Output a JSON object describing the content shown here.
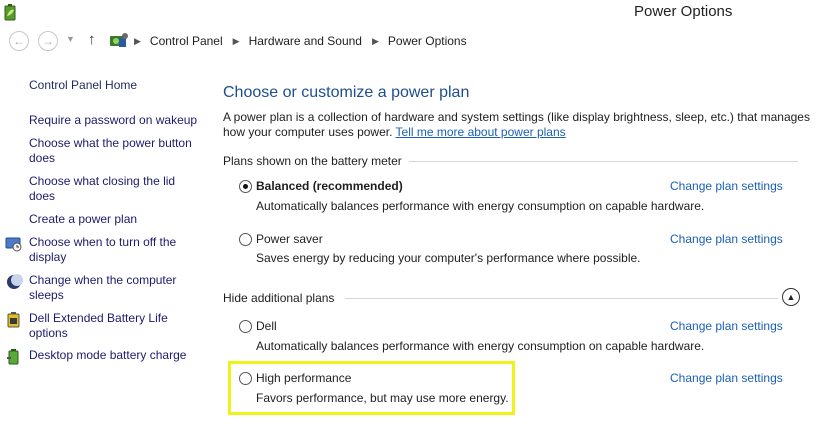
{
  "window": {
    "title": "Power Options",
    "icon": "battery-leaf-icon"
  },
  "address_bar": {
    "back_icon": "back-arrow-icon",
    "forward_icon": "forward-arrow-icon",
    "recent_icon": "chevron-down-icon",
    "up_icon": "up-arrow-icon",
    "crumbs": [
      "Control Panel",
      "Hardware and Sound",
      "Power Options"
    ]
  },
  "sidebar": {
    "home": "Control Panel Home",
    "items": [
      {
        "label": "Require a password on wakeup",
        "icon": ""
      },
      {
        "label": "Choose what the power button does",
        "icon": ""
      },
      {
        "label": "Choose what closing the lid does",
        "icon": ""
      },
      {
        "label": "Create a power plan",
        "icon": ""
      },
      {
        "label": "Choose when to turn off the display",
        "icon": "display-clock-icon"
      },
      {
        "label": "Change when the computer sleeps",
        "icon": "moon-icon"
      },
      {
        "label": "Dell Extended Battery Life options",
        "icon": "dell-battery-icon"
      },
      {
        "label": "Desktop mode battery charge",
        "icon": "battery-plug-icon"
      }
    ]
  },
  "main": {
    "heading": "Choose or customize a power plan",
    "description": "A power plan is a collection of hardware and system settings (like display brightness, sleep, etc.) that manages how your computer uses power.",
    "description_link": "Tell me more about power plans",
    "battery_group": {
      "label": "Plans shown on the battery meter",
      "plans": [
        {
          "name": "Balanced (recommended)",
          "desc": "Automatically balances performance with energy consumption on capable hardware.",
          "selected": true,
          "action": "Change plan settings"
        },
        {
          "name": "Power saver",
          "desc": "Saves energy by reducing your computer's performance where possible.",
          "selected": false,
          "action": "Change plan settings"
        }
      ]
    },
    "additional_group": {
      "label": "Hide additional plans",
      "collapse_icon": "chevron-up-icon",
      "plans": [
        {
          "name": "Dell",
          "desc": "Automatically balances performance with energy consumption on capable hardware.",
          "selected": false,
          "action": "Change plan settings"
        },
        {
          "name": "High performance",
          "desc": "Favors performance, but may use more energy.",
          "selected": false,
          "action": "Change plan settings"
        }
      ]
    }
  },
  "colors": {
    "link": "#1a5fb4",
    "heading": "#1e4e8c",
    "highlight": "#f2f21b"
  }
}
